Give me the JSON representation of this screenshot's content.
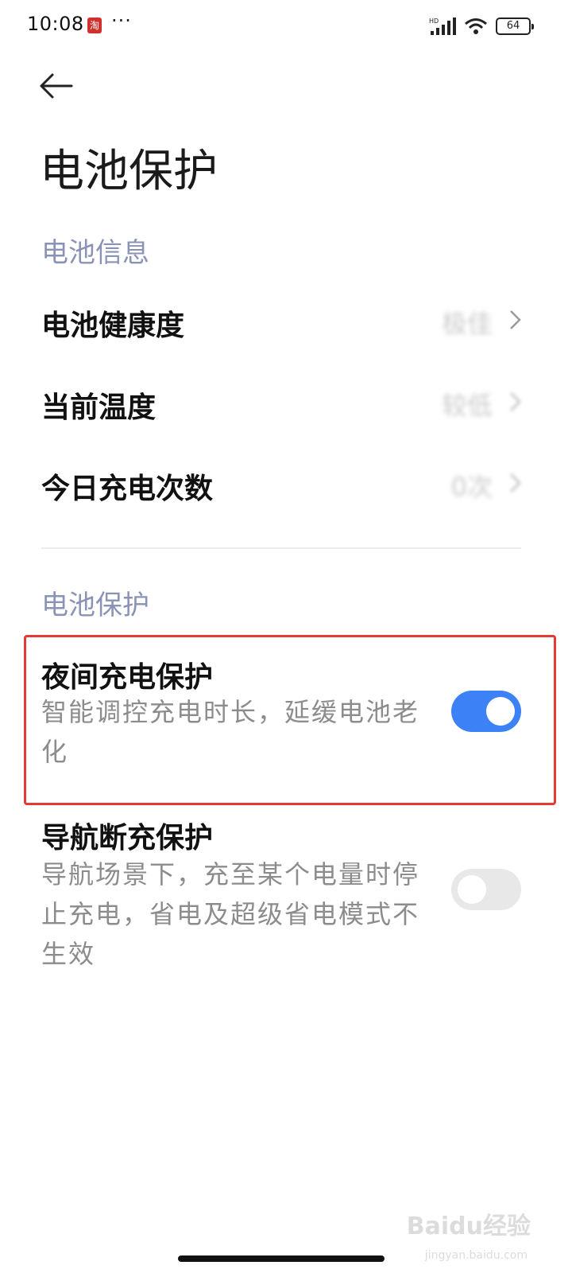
{
  "status_bar": {
    "time": "10:08",
    "app_badge": "淘",
    "more": "···",
    "battery_level": "64",
    "network_tag": "HD"
  },
  "header": {
    "title": "电池保护"
  },
  "sections": {
    "info_header": "电池信息",
    "protect_header": "电池保护"
  },
  "info_rows": [
    {
      "label": "电池健康度",
      "value": "极佳"
    },
    {
      "label": "当前温度",
      "value": "较低"
    },
    {
      "label": "今日充电次数",
      "value": "0次"
    }
  ],
  "toggles": [
    {
      "title": "夜间充电保护",
      "desc": "智能调控充电时长，延缓电池老化",
      "state": "on"
    },
    {
      "title": "导航断充保护",
      "desc": "导航场景下，充至某个电量时停止充电，省电及超级省电模式不生效",
      "state": "off"
    }
  ],
  "watermark": {
    "text": "Baidu经验",
    "sub": "jingyan.baidu.com"
  },
  "colors": {
    "accent": "#3c82f6",
    "section_header": "#8a93b5",
    "highlight": "#e53935"
  }
}
